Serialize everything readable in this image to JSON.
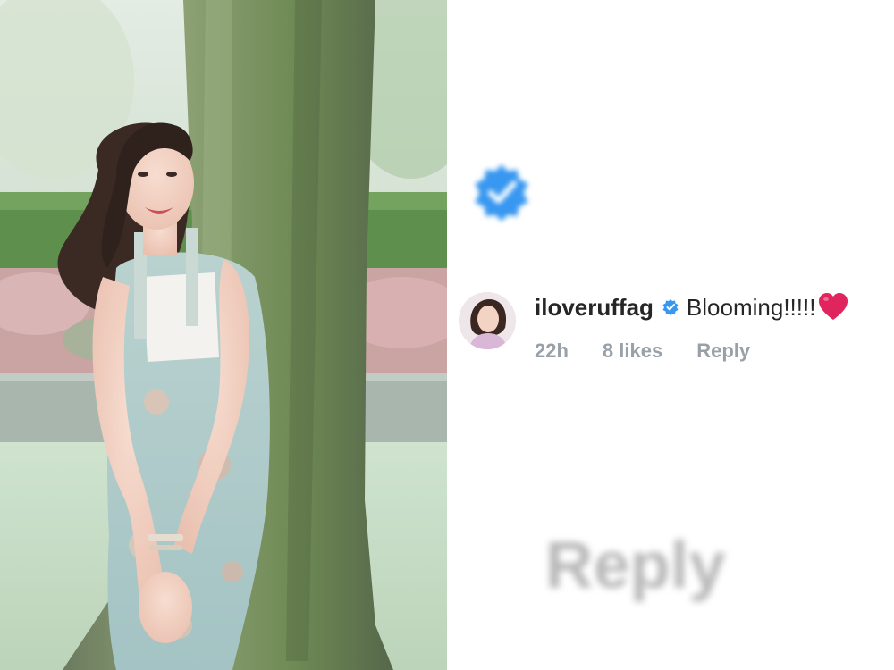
{
  "photo": {
    "subject_icon": "woman-leaning-on-tree"
  },
  "large_badge": {
    "icon": "verified-badge-icon",
    "color": "#3897f0"
  },
  "comment": {
    "avatar_icon": "avatar",
    "username": "iloveruffag",
    "verified_icon": "verified-badge-icon",
    "text": "Blooming!!!!!",
    "emoji": "❤️",
    "time": "22h",
    "likes": "8 likes",
    "reply_label": "Reply"
  },
  "blurred_reply_label": "Reply",
  "colors": {
    "verified": "#3897f0",
    "meta_text": "#9aa0a8",
    "heart": "#e0245e"
  }
}
